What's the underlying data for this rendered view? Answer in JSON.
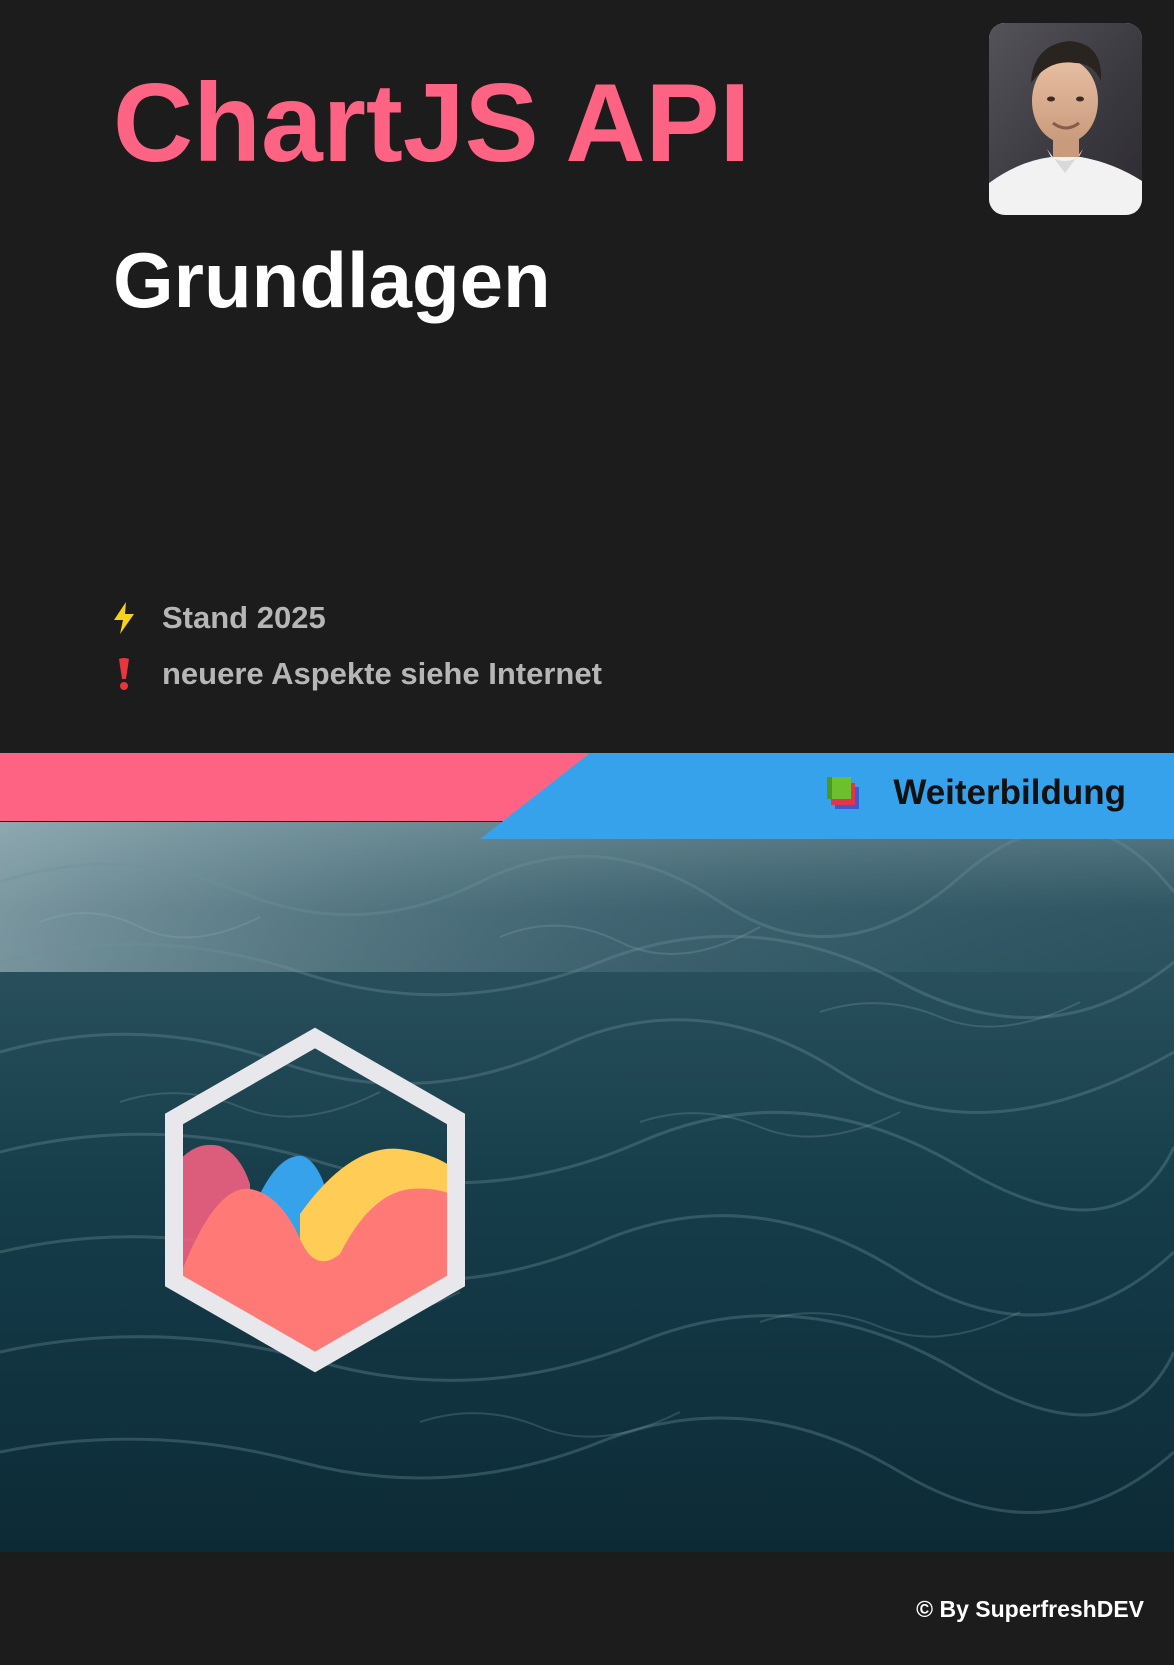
{
  "cover": {
    "title": "ChartJS API",
    "subtitle": "Grundlagen",
    "author_photo_icon": "author-portrait",
    "info": [
      {
        "icon": "lightning-icon",
        "text": "Stand 2025"
      },
      {
        "icon": "exclamation-icon",
        "text": "neuere Aspekte siehe Internet"
      }
    ],
    "ribbon": {
      "icon": "books-icon",
      "label": "Weiterbildung"
    },
    "logo_icon": "chartjs-logo",
    "copyright": "© By SuperfreshDEV"
  },
  "colors": {
    "background": "#1c1c1c",
    "title": "#ff6384",
    "subtitle": "#ffffff",
    "info_text": "#b6b6b6",
    "band_pink": "#ff6384",
    "band_blue": "#36a2eb",
    "logo_red": "#ff6384",
    "logo_yellow": "#ffcd56",
    "logo_blue": "#36a2eb",
    "logo_frame": "#e8e8ec"
  }
}
